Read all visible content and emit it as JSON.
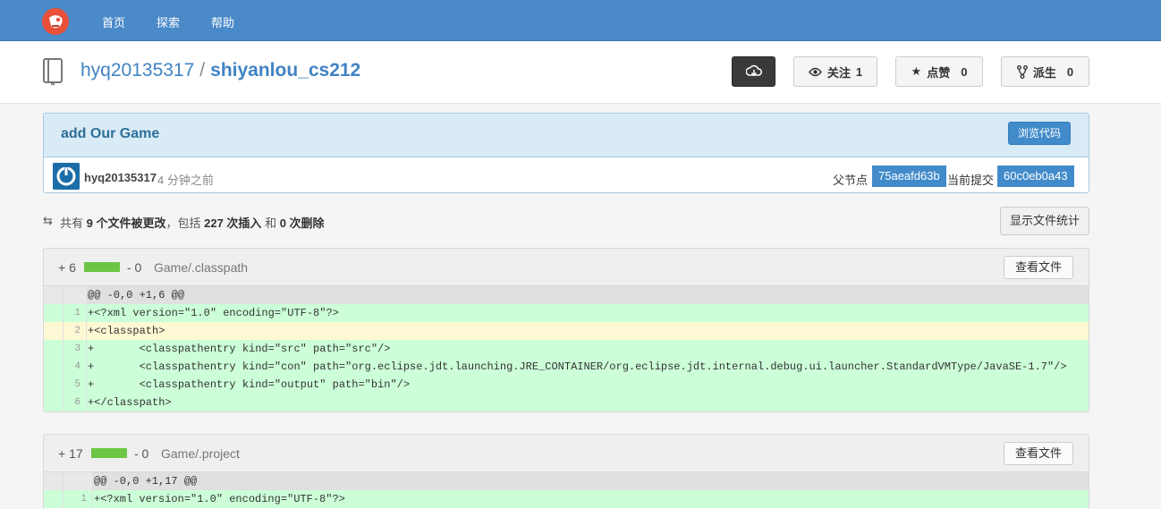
{
  "nav": {
    "home": "首页",
    "explore": "探索",
    "help": "帮助"
  },
  "repo": {
    "owner": "hyq20135317",
    "separator": "/",
    "name": "shiyanlou_cs212"
  },
  "header_buttons": {
    "watch_label": "关注",
    "watch_count": "1",
    "star_label": "点赞",
    "star_count": "0",
    "fork_label": "派生",
    "fork_count": "0"
  },
  "commit": {
    "title": "add Our Game",
    "browse_label": "浏览代码",
    "author": "hyq20135317",
    "time": "4 分钟之前",
    "parent_label": "父节点",
    "parent_sha": "75aeafd63b",
    "current_label": "当前提交",
    "current_sha": "60c0eb0a43"
  },
  "summary": {
    "prefix": "共有",
    "files": "9 个文件被更改",
    "mid1": "，包括",
    "insertions": "227 次插入",
    "mid2": "和",
    "deletions": "0 次删除",
    "stats_button": "显示文件统计"
  },
  "files": [
    {
      "additions": "+ 6",
      "deletions": "- 0",
      "name": "Game/.classpath",
      "view_label": "查看文件",
      "hunk": "@@ -0,0 +1,6 @@",
      "lines": [
        {
          "n": "1",
          "text": "+<?xml version=\"1.0\" encoding=\"UTF-8\"?>"
        },
        {
          "n": "2",
          "text": "+<classpath>"
        },
        {
          "n": "3",
          "text": "+\t<classpathentry kind=\"src\" path=\"src\"/>"
        },
        {
          "n": "4",
          "text": "+\t<classpathentry kind=\"con\" path=\"org.eclipse.jdt.launching.JRE_CONTAINER/org.eclipse.jdt.internal.debug.ui.launcher.StandardVMType/JavaSE-1.7\"/>"
        },
        {
          "n": "5",
          "text": "+\t<classpathentry kind=\"output\" path=\"bin\"/>"
        },
        {
          "n": "6",
          "text": "+</classpath>"
        }
      ]
    },
    {
      "additions": "+ 17",
      "deletions": "- 0",
      "name": "Game/.project",
      "view_label": "查看文件",
      "hunk": "@@ -0,0 +1,17 @@",
      "lines": [
        {
          "n": "1",
          "text": "+<?xml version=\"1.0\" encoding=\"UTF-8\"?>"
        }
      ]
    }
  ],
  "colors": {
    "navbar": "#4a8ac9",
    "link": "#4183c4",
    "sha_badge": "#428bca",
    "added_line": "#ccffd8",
    "diffstat_bar": "#6cc644"
  }
}
